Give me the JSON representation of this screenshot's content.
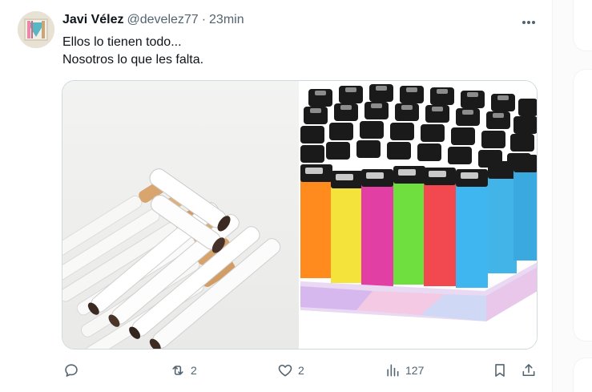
{
  "tweet": {
    "author_name": "Javi Vélez",
    "author_handle": "@develez77",
    "separator": "·",
    "timestamp": "23min",
    "text_line1": "Ellos lo tienen todo...",
    "text_line2": "Nosotros lo que les falta.",
    "media": [
      {
        "subject": "cigarettes"
      },
      {
        "subject": "lighters"
      }
    ]
  },
  "actions": {
    "reply_count": "",
    "retweet_count": "2",
    "like_count": "2",
    "views_count": "127"
  },
  "icons": {
    "more": "more-icon",
    "reply": "reply-icon",
    "retweet": "retweet-icon",
    "like": "heart-icon",
    "views": "views-icon",
    "bookmark": "bookmark-icon",
    "share": "share-icon"
  },
  "colors": {
    "text_primary": "#0f1419",
    "text_secondary": "#536471",
    "border": "#cfd9de",
    "lighter_colors": [
      "#ff8a1e",
      "#f4e33a",
      "#e23fa5",
      "#6fde3f",
      "#f2484f",
      "#3fb6ef"
    ]
  }
}
